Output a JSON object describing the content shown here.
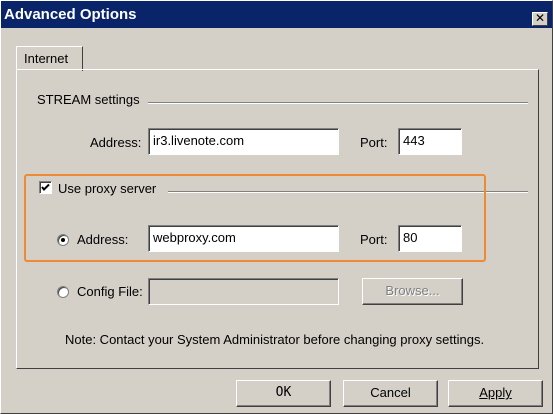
{
  "window": {
    "title": "Advanced Options",
    "close_glyph": "✕"
  },
  "tabs": [
    {
      "label": "Internet"
    }
  ],
  "stream_settings": {
    "group_label": "STREAM settings",
    "address_label": "Address:",
    "address_value": "ir3.livenote.com",
    "port_label": "Port:",
    "port_value": "443"
  },
  "proxy": {
    "checkbox_label": "Use proxy server",
    "checked": true,
    "address_radio_label": "Address:",
    "address_value": "webproxy.com",
    "port_label": "Port:",
    "port_value": "80",
    "address_radio_selected": true,
    "config_file_label": "Config File:",
    "config_file_value": "",
    "browse_label": "Browse..."
  },
  "note": "Note: Contact your System Administrator before changing proxy settings.",
  "buttons": {
    "ok": "OK",
    "cancel": "Cancel",
    "apply": "Apply"
  },
  "colors": {
    "titlebar": "#0a246a",
    "dialog_face": "#d4d0c8",
    "highlight_border": "#ee8a34"
  },
  "icons": {
    "close": "close-icon",
    "checkbox_check": "check-icon",
    "radio_dot": "radio-dot-icon"
  }
}
